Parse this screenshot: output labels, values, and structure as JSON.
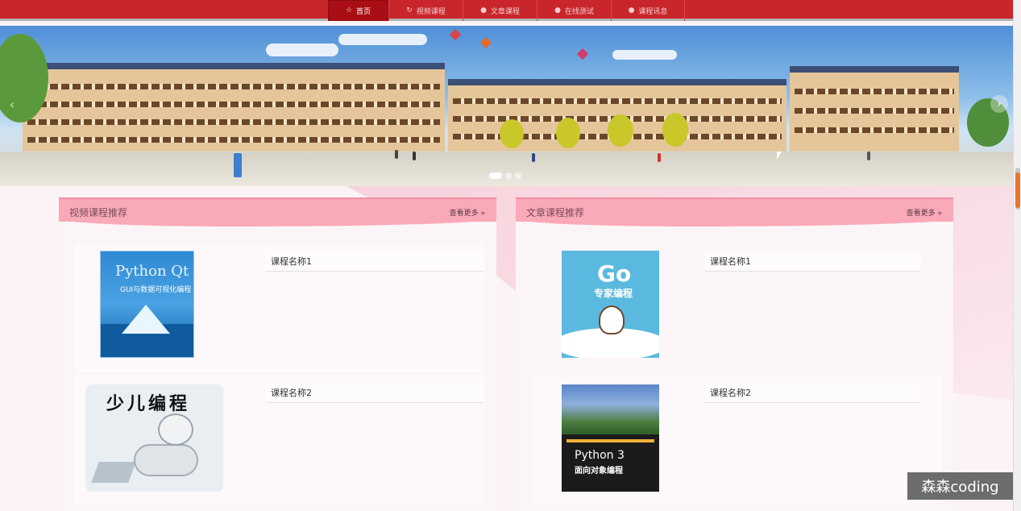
{
  "nav": {
    "items": [
      {
        "label": "首页",
        "icon": "star-icon",
        "active": true
      },
      {
        "label": "视频课程",
        "icon": "refresh-icon",
        "active": false
      },
      {
        "label": "文章课程",
        "icon": "question-circle-icon",
        "active": false
      },
      {
        "label": "在线测试",
        "icon": "question-circle-icon",
        "active": false
      },
      {
        "label": "课程讯息",
        "icon": "question-circle-icon",
        "active": false
      }
    ]
  },
  "carousel": {
    "slides": 3,
    "active_index": 0
  },
  "video_panel": {
    "title": "视频课程推荐",
    "more_label": "查看更多",
    "courses": [
      {
        "name": "课程名称1",
        "cover_title": "Python Qt",
        "cover_subtitle": "GUI与数据可视化编程"
      },
      {
        "name": "课程名称2",
        "cover_title": "少儿编程"
      }
    ]
  },
  "article_panel": {
    "title": "文章课程推荐",
    "more_label": "查看更多",
    "courses": [
      {
        "name": "课程名称1",
        "cover_title": "Go",
        "cover_subtitle": "专家编程"
      },
      {
        "name": "课程名称2",
        "cover_title": "Python 3",
        "cover_subtitle": "面向对象编程"
      }
    ]
  },
  "watermark": "森森coding",
  "colors": {
    "nav": "#c9262b",
    "nav_active": "#a90e14",
    "panel_head": "#f9a9b8"
  }
}
